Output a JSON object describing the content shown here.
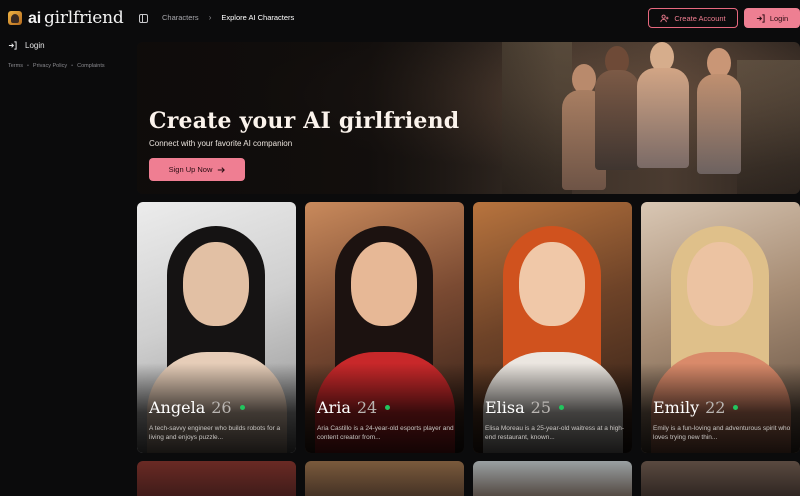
{
  "app": {
    "logo_prefix": "ai",
    "logo_name": "girlfriend"
  },
  "sidebar": {
    "login_label": "Login",
    "footer_links": [
      "Terms",
      "Privacy Policy",
      "Complaints"
    ]
  },
  "header": {
    "breadcrumb": [
      "Characters",
      "Explore AI Characters"
    ],
    "create_account_label": "Create Account",
    "login_label": "Login"
  },
  "hero": {
    "title": "Create your AI girlfriend",
    "subtitle": "Connect with your favorite AI companion",
    "cta_label": "Sign Up Now"
  },
  "characters": [
    {
      "name": "Angela",
      "age": "26",
      "description": "A tech-savvy engineer who builds robots for a living and enjoys puzzle...",
      "online": true
    },
    {
      "name": "Aria",
      "age": "24",
      "description": "Aria Castillo is a 24-year-old esports player and content creator from...",
      "online": true
    },
    {
      "name": "Elisa",
      "age": "25",
      "description": "Elisa Moreau is a 25-year-old waitress at a high-end restaurant, known...",
      "online": true
    },
    {
      "name": "Emily",
      "age": "22",
      "description": "Emily is a fun-loving and adventurous spirit who loves trying new thin...",
      "online": true
    }
  ],
  "colors": {
    "accent": "#ee7f92",
    "online": "#22c55e",
    "background": "#0b0b0c"
  },
  "icons": {
    "logo": "logo-badge-icon",
    "login": "login-arrow-icon",
    "panel": "sidebar-toggle-icon",
    "create_account": "user-plus-icon",
    "cta": "arrow-right-icon"
  }
}
